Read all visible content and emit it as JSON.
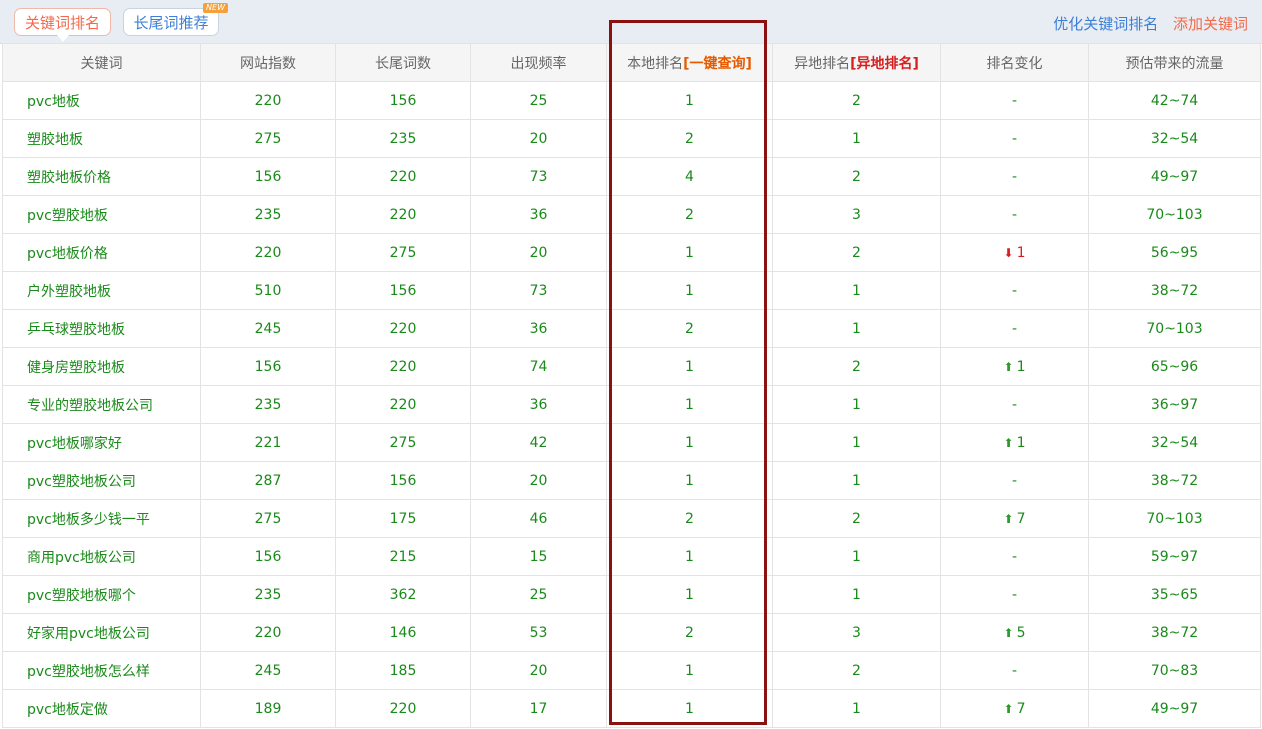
{
  "tabs": {
    "keyword_rank": "关键词排名",
    "longtail": "长尾词推荐",
    "new_badge": "NEW"
  },
  "links": {
    "optimize": "优化关键词排名",
    "add": "添加关键词"
  },
  "columns": {
    "keyword": "关键词",
    "index": "网站指数",
    "longtail": "长尾词数",
    "freq": "出现频率",
    "local": "本地排名",
    "local_query": "[一键查询]",
    "remote": "异地排名",
    "remote_query": "[异地排名]",
    "change": "排名变化",
    "traffic": "预估带来的流量"
  },
  "rows": [
    {
      "kw": "pvc地板",
      "idx": "220",
      "lt": "156",
      "fq": "25",
      "loc": "1",
      "rem": "2",
      "chg": "-",
      "dir": "",
      "tr": "42~74"
    },
    {
      "kw": "塑胶地板",
      "idx": "275",
      "lt": "235",
      "fq": "20",
      "loc": "2",
      "rem": "1",
      "chg": "-",
      "dir": "",
      "tr": "32~54"
    },
    {
      "kw": "塑胶地板价格",
      "idx": "156",
      "lt": "220",
      "fq": "73",
      "loc": "4",
      "rem": "2",
      "chg": "-",
      "dir": "",
      "tr": "49~97"
    },
    {
      "kw": "pvc塑胶地板",
      "idx": "235",
      "lt": "220",
      "fq": "36",
      "loc": "2",
      "rem": "3",
      "chg": "-",
      "dir": "",
      "tr": "70~103"
    },
    {
      "kw": "pvc地板价格",
      "idx": "220",
      "lt": "275",
      "fq": "20",
      "loc": "1",
      "rem": "2",
      "chg": "1",
      "dir": "down",
      "tr": "56~95"
    },
    {
      "kw": "户外塑胶地板",
      "idx": "510",
      "lt": "156",
      "fq": "73",
      "loc": "1",
      "rem": "1",
      "chg": "-",
      "dir": "",
      "tr": "38~72"
    },
    {
      "kw": "乒乓球塑胶地板",
      "idx": "245",
      "lt": "220",
      "fq": "36",
      "loc": "2",
      "rem": "1",
      "chg": "-",
      "dir": "",
      "tr": "70~103"
    },
    {
      "kw": "健身房塑胶地板",
      "idx": "156",
      "lt": "220",
      "fq": "74",
      "loc": "1",
      "rem": "2",
      "chg": "1",
      "dir": "up",
      "tr": "65~96"
    },
    {
      "kw": "专业的塑胶地板公司",
      "idx": "235",
      "lt": "220",
      "fq": "36",
      "loc": "1",
      "rem": "1",
      "chg": "-",
      "dir": "",
      "tr": "36~97"
    },
    {
      "kw": "pvc地板哪家好",
      "idx": "221",
      "lt": "275",
      "fq": "42",
      "loc": "1",
      "rem": "1",
      "chg": "1",
      "dir": "up",
      "tr": "32~54"
    },
    {
      "kw": "pvc塑胶地板公司",
      "idx": "287",
      "lt": "156",
      "fq": "20",
      "loc": "1",
      "rem": "1",
      "chg": "-",
      "dir": "",
      "tr": "38~72"
    },
    {
      "kw": "pvc地板多少钱一平",
      "idx": "275",
      "lt": "175",
      "fq": "46",
      "loc": "2",
      "rem": "2",
      "chg": "7",
      "dir": "up",
      "tr": "70~103"
    },
    {
      "kw": "商用pvc地板公司",
      "idx": "156",
      "lt": "215",
      "fq": "15",
      "loc": "1",
      "rem": "1",
      "chg": "-",
      "dir": "",
      "tr": "59~97"
    },
    {
      "kw": "pvc塑胶地板哪个",
      "idx": "235",
      "lt": "362",
      "fq": "25",
      "loc": "1",
      "rem": "1",
      "chg": "-",
      "dir": "",
      "tr": "35~65"
    },
    {
      "kw": "好家用pvc地板公司",
      "idx": "220",
      "lt": "146",
      "fq": "53",
      "loc": "2",
      "rem": "3",
      "chg": "5",
      "dir": "up",
      "tr": "38~72"
    },
    {
      "kw": "pvc塑胶地板怎么样",
      "idx": "245",
      "lt": "185",
      "fq": "20",
      "loc": "1",
      "rem": "2",
      "chg": "-",
      "dir": "",
      "tr": "70~83"
    },
    {
      "kw": "pvc地板定做",
      "idx": "189",
      "lt": "220",
      "fq": "17",
      "loc": "1",
      "rem": "1",
      "chg": "7",
      "dir": "up",
      "tr": "49~97"
    }
  ]
}
